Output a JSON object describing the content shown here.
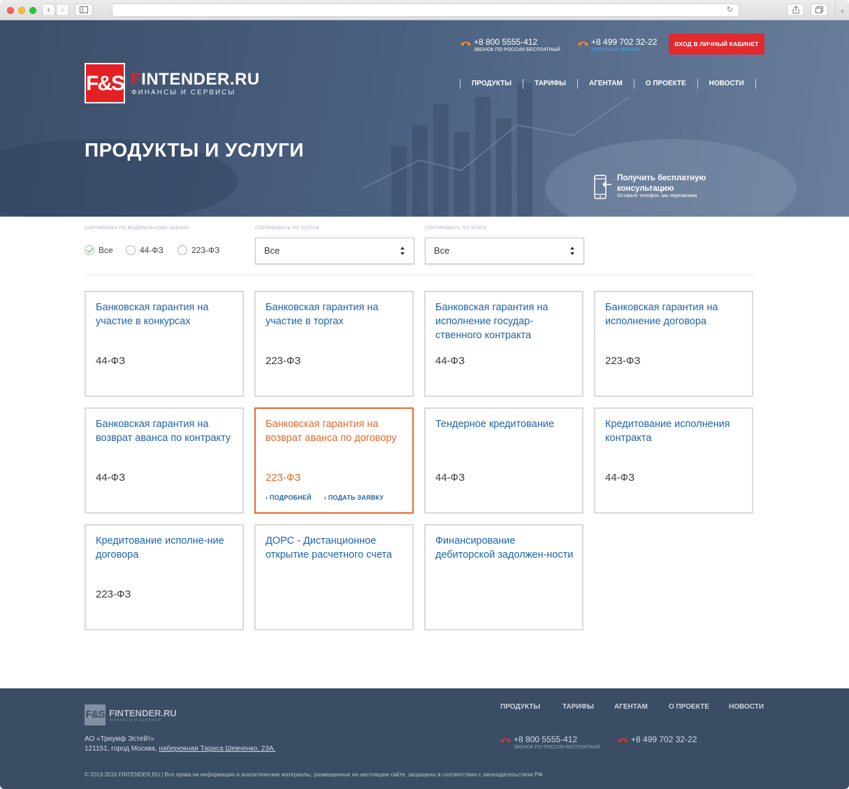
{
  "site": {
    "logo_text_first": "F",
    "logo_text_rest": "INTENDER.RU",
    "logo_badge": "F&S",
    "logo_subtitle": "ФИНАНСЫ И СЕРВИСЫ"
  },
  "header": {
    "phone1": {
      "number": "+8 800 5555-412",
      "note": "ЗВОНОК ПО РОССИИ БЕСПЛАТНЫЙ"
    },
    "phone2": {
      "number": "+8 499 702 32-22",
      "note": "ОБРАТНЫЙ ЗВОНОК"
    },
    "login_button": "ВХОД В ЛИЧНЫЙ КАБИНЕТ",
    "nav": [
      "ПРОДУКТЫ",
      "ТАРИФЫ",
      "АГЕНТАМ",
      "О ПРОЕКТЕ",
      "НОВОСТИ"
    ],
    "page_title": "ПРОДУКТЫ И УСЛУГИ",
    "consult": {
      "title": "Получить бесплатную консультацию",
      "subtitle": "Оставьте телефон, мы перезвоним"
    }
  },
  "filters": {
    "law_label": "СОРТИРОВКА ПО ФЕДЕРАЛЬНОМУ ЗАКОНУ",
    "law_options": [
      "Все",
      "44-ФЗ",
      "223-ФЗ"
    ],
    "law_selected": "Все",
    "service_label": "СОРТИРОВАТЬ ПО УСЛУГЕ",
    "service_value": "Все",
    "stage_label": "СОРТИРОВАТЬ ПО ЭТАПУ",
    "stage_value": "Все"
  },
  "products": [
    {
      "title": "Банковская гарантия на участие в конкурсах",
      "law": "44-ФЗ"
    },
    {
      "title": "Банковская гарантия на участие в торгах",
      "law": "223-ФЗ"
    },
    {
      "title": "Банковская гарантия на исполнение государ-ственного контракта",
      "law": "44-ФЗ"
    },
    {
      "title": "Банковская гарантия на исполнение договора",
      "law": "223-ФЗ"
    },
    {
      "title": "Банковская гарантия на возврат аванса по контракту",
      "law": "44-ФЗ"
    },
    {
      "title": "Банковская гарантия на возврат аванса по договору",
      "law": "223-ФЗ",
      "link_more": "ПОДРОБНЕЙ",
      "link_apply": "ПОДАТЬ ЗАЯВКУ"
    },
    {
      "title": "Тендерное кредитование",
      "law": "44-ФЗ"
    },
    {
      "title": "Кредитование исполнения контракта",
      "law": "44-ФЗ"
    },
    {
      "title": "Кредитование исполне-ние договора",
      "law": "223-ФЗ"
    },
    {
      "title": "ДОРС - Дистанционное открытие расчетного счета",
      "law": ""
    },
    {
      "title": "Финансирование дебиторской задолжен-ности",
      "law": ""
    }
  ],
  "footer": {
    "logo_name": "FINTENDER.RU",
    "logo_badge": "F&S",
    "logo_sub": "ФИНАНСЫ И СЕРВИСЫ",
    "nav": [
      "ПРОДУКТЫ",
      "ТАРИФЫ",
      "АГЕНТАМ",
      "О ПРОЕКТЕ",
      "НОВОСТИ"
    ],
    "company": "АО «Триумф Эстейт»",
    "address_prefix": "121151, город Москва, ",
    "address_link": "набережная Тараса Шевченко, 23А.",
    "phone1": {
      "number": "+8 800 5555-412",
      "note": "ЗВОНОК ПО РОССИИ БЕСПЛАТНЫЙ"
    },
    "phone2": {
      "number": "+8 499 702 32-22"
    },
    "copyright": "© 2013-2016 FINTENDER.RU |  Все права на информацию и аналитические материалы, размещенные на настоящем сайте, защищены в соответствии с законодательством РФ."
  },
  "colors": {
    "brand_red": "#e42024",
    "link_blue": "#1d64ad",
    "active_orange": "#e8692d",
    "footer_bg": "#3a4d64"
  }
}
